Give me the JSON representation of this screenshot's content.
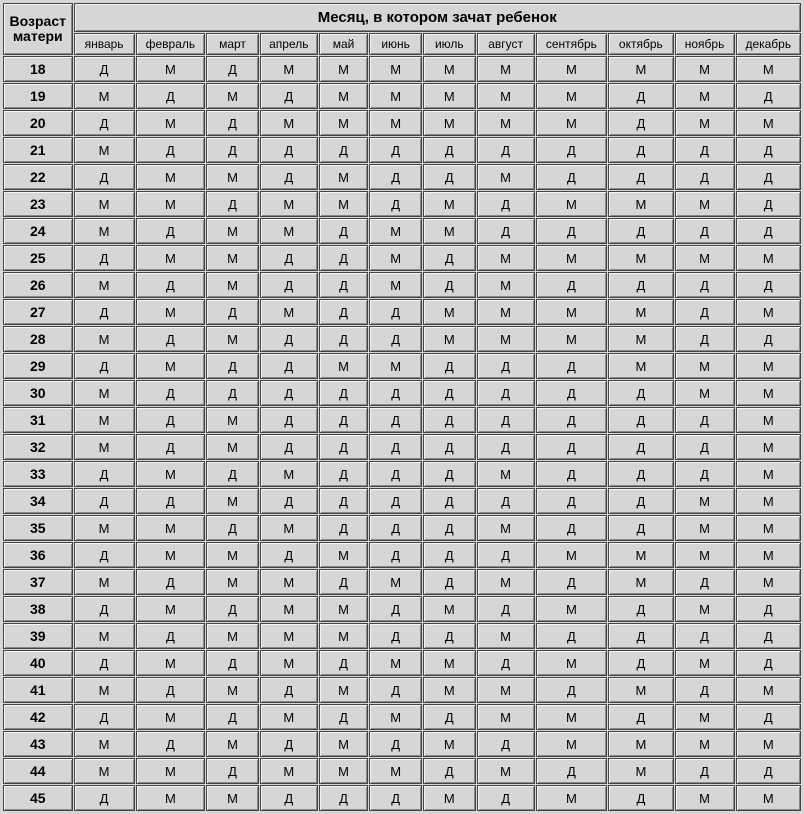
{
  "header": {
    "row_label_line1": "Возраст",
    "row_label_line2": "матери",
    "main_title": "Месяц, в котором зачат ребенок",
    "months": [
      "январь",
      "февраль",
      "март",
      "апрель",
      "май",
      "июнь",
      "июль",
      "август",
      "сентябрь",
      "октябрь",
      "ноябрь",
      "декабрь"
    ]
  },
  "rows": [
    {
      "age": "18",
      "cells": [
        "Д",
        "М",
        "Д",
        "М",
        "М",
        "М",
        "М",
        "М",
        "М",
        "М",
        "М",
        "М"
      ]
    },
    {
      "age": "19",
      "cells": [
        "М",
        "Д",
        "М",
        "Д",
        "М",
        "М",
        "М",
        "М",
        "М",
        "Д",
        "М",
        "Д"
      ]
    },
    {
      "age": "20",
      "cells": [
        "Д",
        "М",
        "Д",
        "М",
        "М",
        "М",
        "М",
        "М",
        "М",
        "Д",
        "М",
        "М"
      ]
    },
    {
      "age": "21",
      "cells": [
        "М",
        "Д",
        "Д",
        "Д",
        "Д",
        "Д",
        "Д",
        "Д",
        "Д",
        "Д",
        "Д",
        "Д"
      ]
    },
    {
      "age": "22",
      "cells": [
        "Д",
        "М",
        "М",
        "Д",
        "М",
        "Д",
        "Д",
        "М",
        "Д",
        "Д",
        "Д",
        "Д"
      ]
    },
    {
      "age": "23",
      "cells": [
        "М",
        "М",
        "Д",
        "М",
        "М",
        "Д",
        "М",
        "Д",
        "М",
        "М",
        "М",
        "Д"
      ]
    },
    {
      "age": "24",
      "cells": [
        "М",
        "Д",
        "М",
        "М",
        "Д",
        "М",
        "М",
        "Д",
        "Д",
        "Д",
        "Д",
        "Д"
      ]
    },
    {
      "age": "25",
      "cells": [
        "Д",
        "М",
        "М",
        "Д",
        "Д",
        "М",
        "Д",
        "М",
        "М",
        "М",
        "М",
        "М"
      ]
    },
    {
      "age": "26",
      "cells": [
        "М",
        "Д",
        "М",
        "Д",
        "Д",
        "М",
        "Д",
        "М",
        "Д",
        "Д",
        "Д",
        "Д"
      ]
    },
    {
      "age": "27",
      "cells": [
        "Д",
        "М",
        "Д",
        "М",
        "Д",
        "Д",
        "М",
        "М",
        "М",
        "М",
        "Д",
        "М"
      ]
    },
    {
      "age": "28",
      "cells": [
        "М",
        "Д",
        "М",
        "Д",
        "Д",
        "Д",
        "М",
        "М",
        "М",
        "М",
        "Д",
        "Д"
      ]
    },
    {
      "age": "29",
      "cells": [
        "Д",
        "М",
        "Д",
        "Д",
        "М",
        "М",
        "Д",
        "Д",
        "Д",
        "М",
        "М",
        "М"
      ]
    },
    {
      "age": "30",
      "cells": [
        "М",
        "Д",
        "Д",
        "Д",
        "Д",
        "Д",
        "Д",
        "Д",
        "Д",
        "Д",
        "М",
        "М"
      ]
    },
    {
      "age": "31",
      "cells": [
        "М",
        "Д",
        "М",
        "Д",
        "Д",
        "Д",
        "Д",
        "Д",
        "Д",
        "Д",
        "Д",
        "М"
      ]
    },
    {
      "age": "32",
      "cells": [
        "М",
        "Д",
        "М",
        "Д",
        "Д",
        "Д",
        "Д",
        "Д",
        "Д",
        "Д",
        "Д",
        "М"
      ]
    },
    {
      "age": "33",
      "cells": [
        "Д",
        "М",
        "Д",
        "М",
        "Д",
        "Д",
        "Д",
        "М",
        "Д",
        "Д",
        "Д",
        "М"
      ]
    },
    {
      "age": "34",
      "cells": [
        "Д",
        "Д",
        "М",
        "Д",
        "Д",
        "Д",
        "Д",
        "Д",
        "Д",
        "Д",
        "М",
        "М"
      ]
    },
    {
      "age": "35",
      "cells": [
        "М",
        "М",
        "Д",
        "М",
        "Д",
        "Д",
        "Д",
        "М",
        "Д",
        "Д",
        "М",
        "М"
      ]
    },
    {
      "age": "36",
      "cells": [
        "Д",
        "М",
        "М",
        "Д",
        "М",
        "Д",
        "Д",
        "Д",
        "М",
        "М",
        "М",
        "М"
      ]
    },
    {
      "age": "37",
      "cells": [
        "М",
        "Д",
        "М",
        "М",
        "Д",
        "М",
        "Д",
        "М",
        "Д",
        "М",
        "Д",
        "М"
      ]
    },
    {
      "age": "38",
      "cells": [
        "Д",
        "М",
        "Д",
        "М",
        "М",
        "Д",
        "М",
        "Д",
        "М",
        "Д",
        "М",
        "Д"
      ]
    },
    {
      "age": "39",
      "cells": [
        "М",
        "Д",
        "М",
        "М",
        "М",
        "Д",
        "Д",
        "М",
        "Д",
        "Д",
        "Д",
        "Д"
      ]
    },
    {
      "age": "40",
      "cells": [
        "Д",
        "М",
        "Д",
        "М",
        "Д",
        "М",
        "М",
        "Д",
        "М",
        "Д",
        "М",
        "Д"
      ]
    },
    {
      "age": "41",
      "cells": [
        "М",
        "Д",
        "М",
        "Д",
        "М",
        "Д",
        "М",
        "М",
        "Д",
        "М",
        "Д",
        "М"
      ]
    },
    {
      "age": "42",
      "cells": [
        "Д",
        "М",
        "Д",
        "М",
        "Д",
        "М",
        "Д",
        "М",
        "М",
        "Д",
        "М",
        "Д"
      ]
    },
    {
      "age": "43",
      "cells": [
        "М",
        "Д",
        "М",
        "Д",
        "М",
        "Д",
        "М",
        "Д",
        "М",
        "М",
        "М",
        "М"
      ]
    },
    {
      "age": "44",
      "cells": [
        "М",
        "М",
        "Д",
        "М",
        "М",
        "М",
        "Д",
        "М",
        "Д",
        "М",
        "Д",
        "Д"
      ]
    },
    {
      "age": "45",
      "cells": [
        "Д",
        "М",
        "М",
        "Д",
        "Д",
        "Д",
        "М",
        "Д",
        "М",
        "Д",
        "М",
        "М"
      ]
    }
  ]
}
